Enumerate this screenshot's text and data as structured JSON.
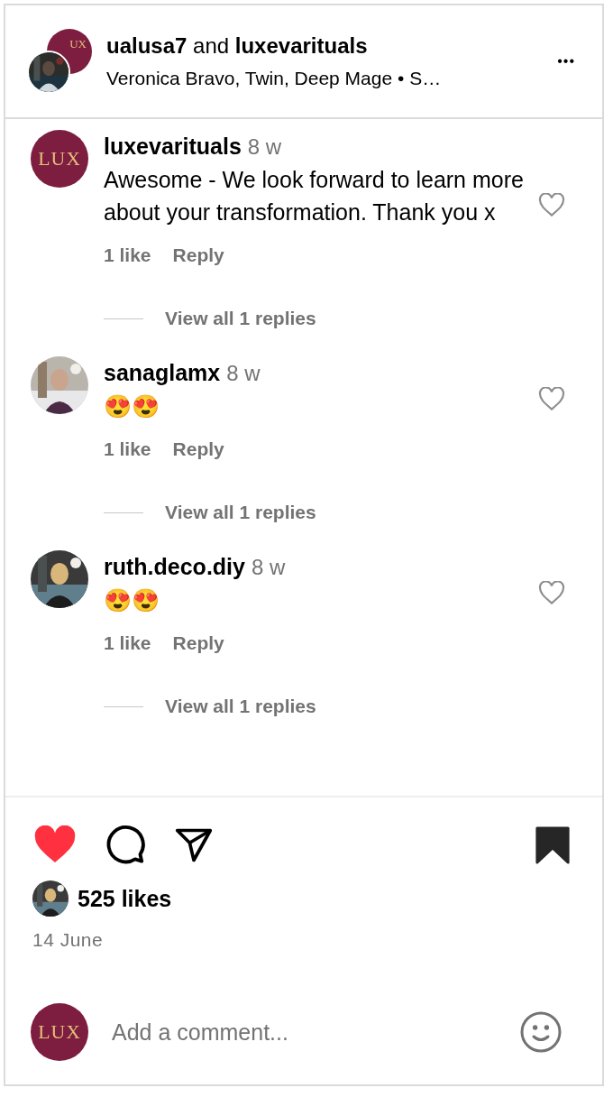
{
  "header": {
    "owner": "ualusa7",
    "joiner": "and",
    "collaborator": "luxevarituals",
    "back_avatar_logo": "UX",
    "subtitle": "Veronica Bravo, Twin, Deep Mage • S…",
    "more": "•••"
  },
  "comments": [
    {
      "username": "luxevarituals",
      "time": "8 w",
      "text": "Awesome - We look forward to learn more about your transformation. Thank you x",
      "avatar": {
        "kind": "logo",
        "logo": "LUX"
      },
      "likes": "1 like",
      "reply": "Reply",
      "view_replies": "View all 1 replies",
      "liked": false
    },
    {
      "username": "sanaglamx",
      "time": "8 w",
      "text": "😍😍",
      "likes": "1 like",
      "reply": "Reply",
      "view_replies": "View all 1 replies",
      "liked": false
    },
    {
      "username": "ruth.deco.diy",
      "time": "8 w",
      "text": "😍😍",
      "likes": "1 like",
      "reply": "Reply",
      "view_replies": "View all 1 replies",
      "liked": false
    }
  ],
  "actions": {
    "liked": true,
    "saved": true
  },
  "likes": "525 likes",
  "date": "14 June",
  "composer": {
    "avatar_logo": "LUX",
    "placeholder": "Add a comment..."
  }
}
